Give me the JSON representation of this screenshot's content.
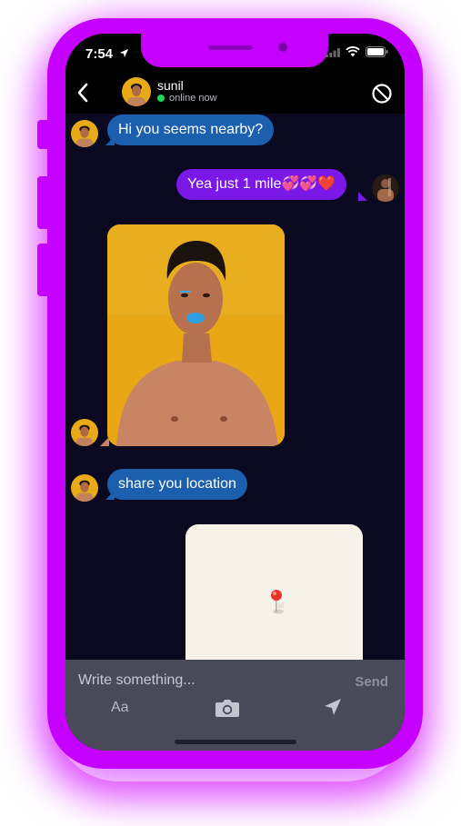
{
  "status": {
    "time": "7:54"
  },
  "header": {
    "contact_name": "sunil",
    "presence": "online now"
  },
  "messages": [
    {
      "direction": "in",
      "text": "Hi you seems nearby?"
    },
    {
      "direction": "out",
      "text": "Yea just 1 mile💞💞❤️"
    },
    {
      "direction": "in",
      "type": "photo"
    },
    {
      "direction": "in",
      "text": "share you location"
    },
    {
      "direction": "out",
      "type": "location"
    }
  ],
  "composer": {
    "placeholder": "Write something...",
    "send_label": "Send",
    "font_label": "Aa"
  },
  "colors": {
    "phone_frame": "#c600ff",
    "screen_bg": "#0b0920",
    "incoming_bubble": "#1b5fae",
    "outgoing_bubble": "#7a18e8",
    "online_dot": "#1ed760",
    "composer_bg": "#484a5a"
  },
  "icons": [
    "location-arrow-icon",
    "signal-icon",
    "wifi-icon",
    "battery-icon",
    "back-chevron-icon",
    "block-icon",
    "camera-icon",
    "send-location-icon",
    "map-pin-icon"
  ]
}
